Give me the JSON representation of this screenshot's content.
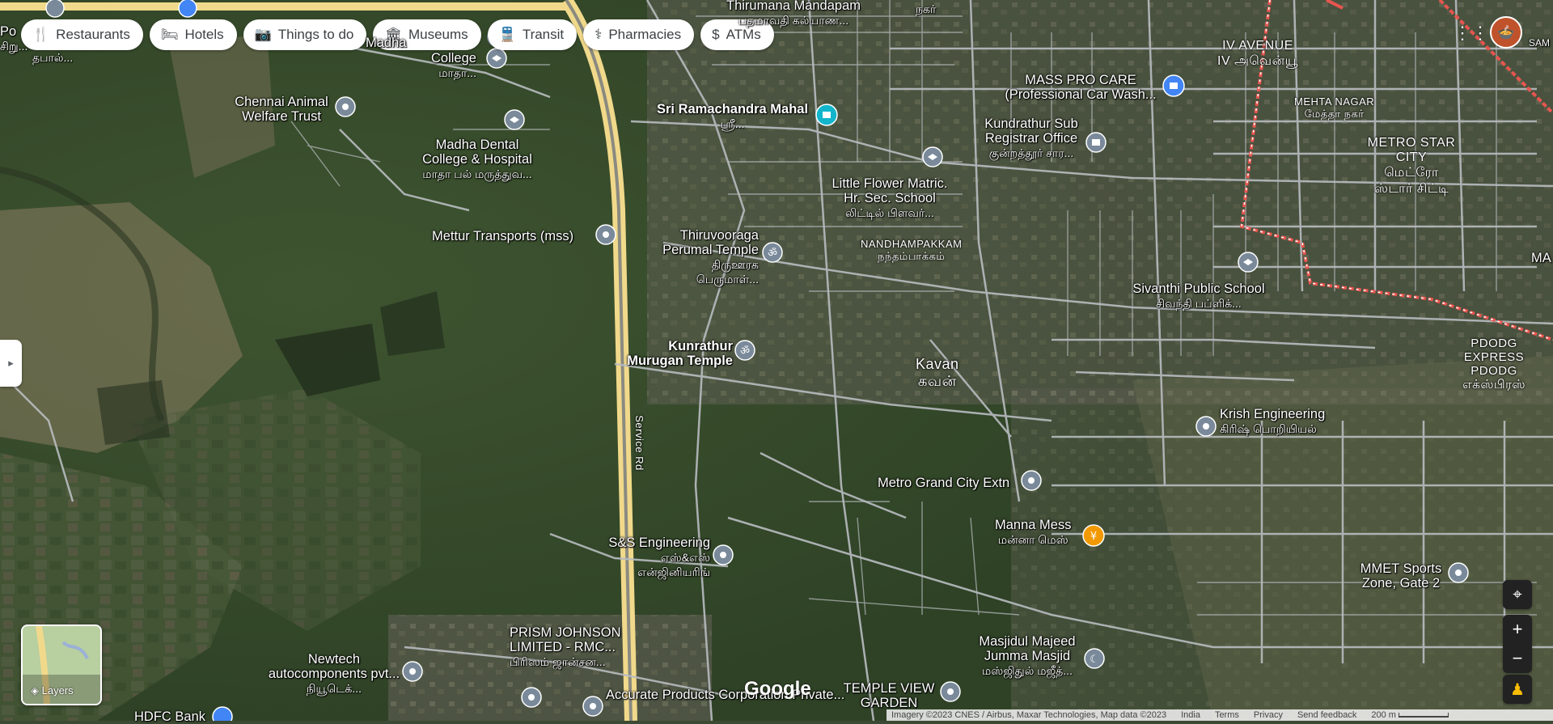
{
  "chips": [
    {
      "label": "Restaurants",
      "icon": "fork-knife-icon"
    },
    {
      "label": "Hotels",
      "icon": "bed-icon"
    },
    {
      "label": "Things to do",
      "icon": "camera-icon"
    },
    {
      "label": "Museums",
      "icon": "museum-icon"
    },
    {
      "label": "Transit",
      "icon": "train-icon"
    },
    {
      "label": "Pharmacies",
      "icon": "pharmacy-icon"
    },
    {
      "label": "ATMs",
      "icon": "atm-icon"
    }
  ],
  "places": [
    {
      "name": "Thirumana Mandapam",
      "native": "பதமாவதி கல்யாண...",
      "type": "generic"
    },
    {
      "name": "College",
      "native": "மாதா...",
      "type": "school"
    },
    {
      "name": "Chennai Animal Welfare Trust",
      "native": "",
      "type": "generic"
    },
    {
      "name": "Madha Dental College & Hospital",
      "native": "மாதா பல் மருத்துவ...",
      "type": "school"
    },
    {
      "name": "Mettur Transports (mss)",
      "native": "",
      "type": "generic"
    },
    {
      "name": "Sri Ramachandra Mahal",
      "native": "ஸ்ரீ...",
      "type": "venue"
    },
    {
      "name": "Thiruvooraga Perumal Temple",
      "native": "திருஊரக பெருமாள்...",
      "type": "temple"
    },
    {
      "name": "Kunrathur Murugan Temple",
      "native": "",
      "type": "temple"
    },
    {
      "name": "Little Flower Matric. Hr. Sec. School",
      "native": "லிட்டில் பிளவர்...",
      "type": "school"
    },
    {
      "name": "Kundrathur Sub Registrar Office",
      "native": "குன்றத்தூர் சார...",
      "type": "office"
    },
    {
      "name": "MASS PRO CARE (Professional Car Wash...",
      "native": "",
      "type": "shop"
    },
    {
      "name": "Sivanthi Public School",
      "native": "சிவந்தி பப்ளிக்...",
      "type": "school"
    },
    {
      "name": "Krish Engineering",
      "native": "கிரிஷ் பொறியியல்",
      "type": "generic"
    },
    {
      "name": "Metro Grand City Extn",
      "native": "",
      "type": "generic"
    },
    {
      "name": "Manna Mess",
      "native": "மன்னா மெஸ்",
      "type": "restaurant"
    },
    {
      "name": "S&S Engineering",
      "native": "எஸ்&எஸ் என்ஜினியரிங்",
      "type": "generic"
    },
    {
      "name": "MMET Sports Zone, Gate 2",
      "native": "",
      "type": "generic"
    },
    {
      "name": "PRISM JOHNSON LIMITED - RMC...",
      "native": "பிரிஸம் ஜான்சன...",
      "type": "generic"
    },
    {
      "name": "Newtech autocomponents pvt...",
      "native": "நியூடெக்...",
      "type": "generic"
    },
    {
      "name": "Accurate Products Corporation Private...",
      "native": "",
      "type": "generic"
    },
    {
      "name": "Masjidul Majeed Jumma Masjid",
      "native": "மஸ்ஜிதுல் மஜீத்...",
      "type": "mosque"
    },
    {
      "name": "TEMPLE VIEW GARDEN",
      "native": "",
      "type": "generic"
    },
    {
      "name": "HDFC Bank",
      "native": "",
      "type": "bank"
    }
  ],
  "areas": [
    {
      "name": "IV AVENUE",
      "native": "IV அவென்யூ"
    },
    {
      "name": "MEHTA NAGAR",
      "native": "மேத்தா நகர்"
    },
    {
      "name": "METRO STAR CITY",
      "native": "மெட்ரோ ஸ்டார் சிட்டி"
    },
    {
      "name": "NANDHAMPAKKAM",
      "native": "நந்தம்பாக்கம்"
    },
    {
      "name": "Kavan",
      "native": "கவன்"
    },
    {
      "name": "PDODG EXPRESS PDODG",
      "native": "எக்ஸ்பிரஸ்"
    },
    {
      "name": "Service Rd",
      "native": ""
    }
  ],
  "partial_labels": {
    "left_edge": "Po",
    "left_edge_native": "சிறு...",
    "top_left_college": "Madha",
    "top_left_native": "தபால்...",
    "top_nagar": "நகர்",
    "far_right": "MA",
    "far_right_2": "SAM"
  },
  "controls": {
    "layers_label": "Layers",
    "zoom_in": "+",
    "zoom_out": "−",
    "side_panel_toggle": "▸"
  },
  "branding": {
    "logo_text": "Google"
  },
  "footer": {
    "imagery": "Imagery ©2023 CNES / Airbus, Maxar Technologies, Map data ©2023",
    "country": "India",
    "terms": "Terms",
    "privacy": "Privacy",
    "feedback": "Send feedback",
    "scale": "200 m"
  },
  "colors": {
    "pin_default": "#5f7d95",
    "pin_food": "#f29900",
    "pin_school": "#4d6e8a",
    "pin_temple": "#4d6e8a",
    "pin_venue": "#12b5cb",
    "boundary": "#e8554f",
    "road": "#b8bcc0",
    "highway": "#f1d98b"
  }
}
